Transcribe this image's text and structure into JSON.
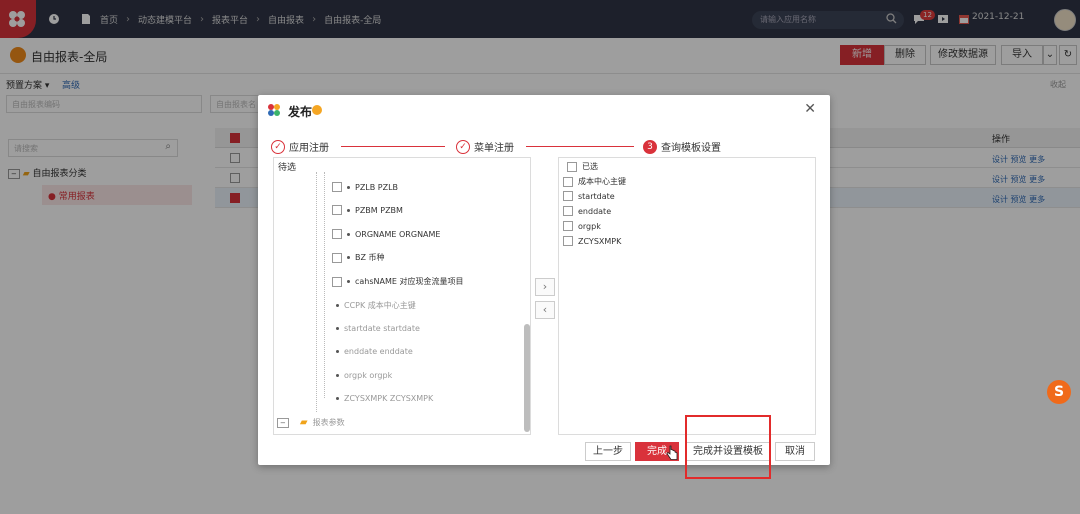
{
  "topbar": {
    "crumbs": [
      "首页",
      "动态建模平台",
      "报表平台",
      "自由报表",
      "自由报表-全局"
    ],
    "search_placeholder": "请输入应用名称",
    "notification_count": "12",
    "date": "2021-12-21"
  },
  "page": {
    "title": "自由报表-全局",
    "buttons": {
      "add": "新增",
      "delete": "删除",
      "edit_source": "修改数据源",
      "import": "导入"
    }
  },
  "filters": {
    "preset_label": "预置方案",
    "advanced_label": "高级",
    "collapse_label": "收起",
    "input1_placeholder": "自由报表编码",
    "input2_placeholder": "自由报表名"
  },
  "left_tree": {
    "search_placeholder": "请搜索",
    "root": "自由报表分类",
    "child": "常用报表"
  },
  "table": {
    "ops_header": "操作",
    "ops_text": "设计 预览 更多"
  },
  "dialog": {
    "title": "发布",
    "steps": [
      {
        "num": "",
        "label": "应用注册"
      },
      {
        "num": "",
        "label": "菜单注册"
      },
      {
        "num": "3",
        "label": "查询模板设置"
      }
    ],
    "left_header": "待选",
    "left_items": [
      {
        "text": "PZLB  PZLB",
        "checkbox": true
      },
      {
        "text": "PZBM  PZBM",
        "checkbox": true
      },
      {
        "text": "ORGNAME  ORGNAME",
        "checkbox": true
      },
      {
        "text": "BZ  币种",
        "checkbox": true
      },
      {
        "text": "cahsNAME  对应现金流量项目",
        "checkbox": true
      },
      {
        "text": "CCPK  成本中心主键",
        "checkbox": false
      },
      {
        "text": "startdate  startdate",
        "checkbox": false
      },
      {
        "text": "enddate  enddate",
        "checkbox": false
      },
      {
        "text": "orgpk  orgpk",
        "checkbox": false
      },
      {
        "text": "ZCYSXMPK  ZCYSXMPK",
        "checkbox": false
      }
    ],
    "left_folder": "报表参数",
    "right_header": "已选",
    "right_items": [
      "成本中心主键",
      "startdate",
      "enddate",
      "orgpk",
      "ZCYSXMPK"
    ],
    "buttons": {
      "prev": "上一步",
      "finish": "完成",
      "finish_template": "完成并设置模板",
      "cancel": "取消"
    }
  }
}
